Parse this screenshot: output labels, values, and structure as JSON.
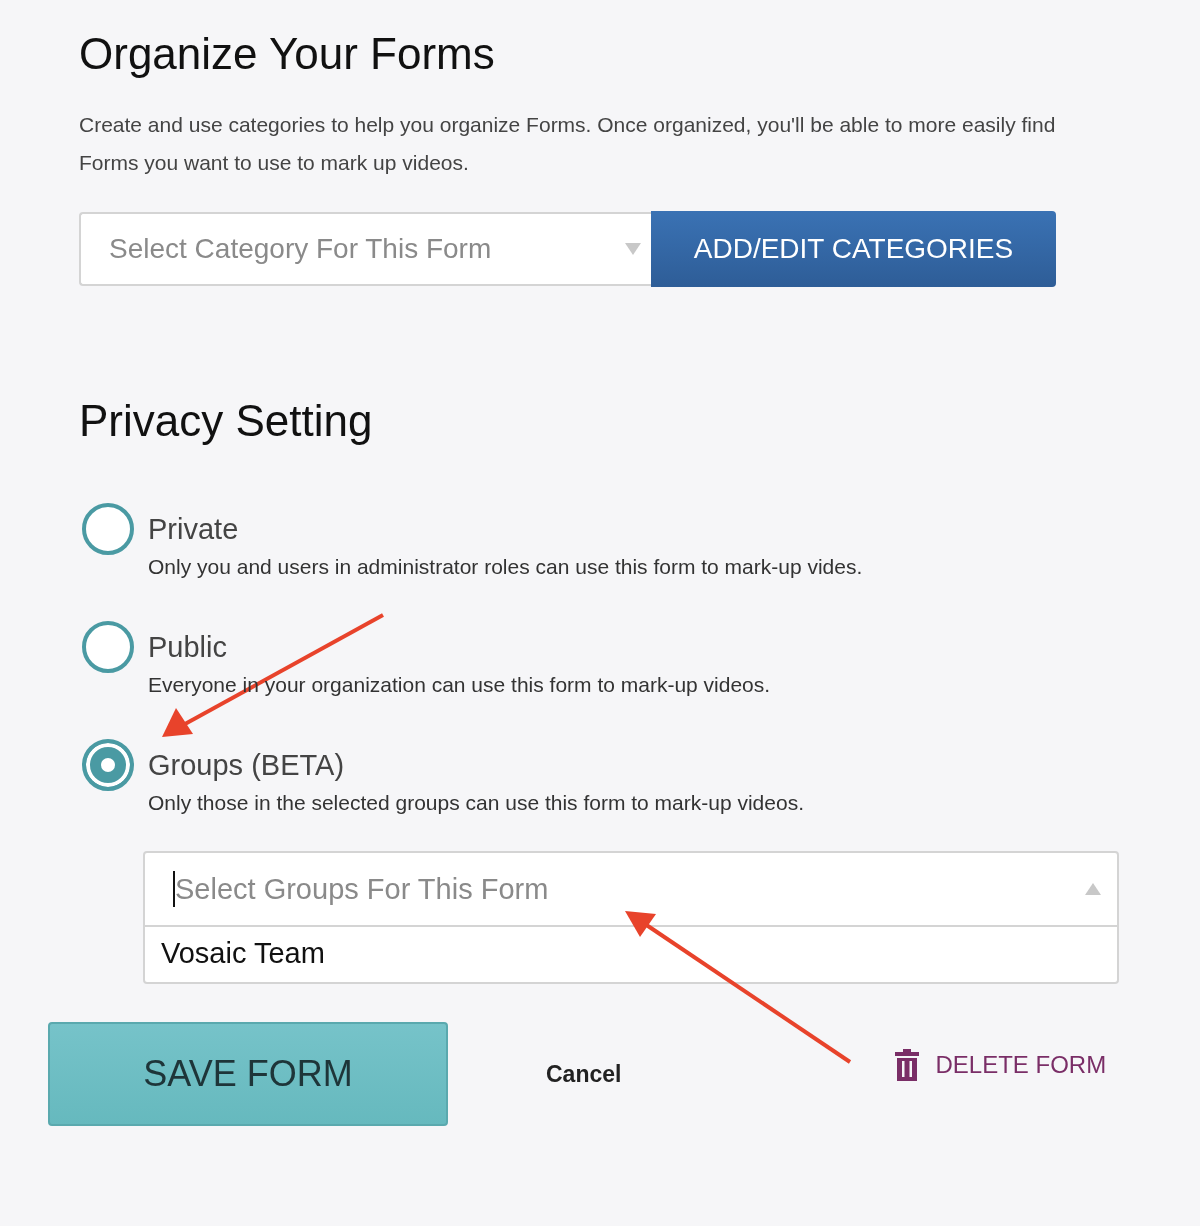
{
  "categories": {
    "title": "Organize Your Forms",
    "description": "Create and use categories to help you organize Forms. Once organized, you'll be able to more easily find Forms you want to use to mark up videos.",
    "select": {
      "placeholder": "Select Category For This Form",
      "expanded": false
    },
    "button": "ADD/EDIT CATEGORIES"
  },
  "privacy": {
    "title": "Privacy Setting",
    "options": [
      {
        "label": "Private",
        "description": "Only you and users in administrator roles can use this form to mark-up vides.",
        "selected": false
      },
      {
        "label": "Public",
        "description": "Everyone in your organization can use this form to mark-up videos.",
        "selected": false
      },
      {
        "label": "Groups (BETA)",
        "description": "Only those in the selected groups can use this form to mark-up videos.",
        "selected": true
      }
    ],
    "groups": {
      "placeholder": "Select Groups For This Form",
      "expanded": true,
      "options": [
        "Vosaic Team"
      ]
    }
  },
  "actions": {
    "save": "SAVE FORM",
    "cancel": "Cancel",
    "delete": "DELETE FORM"
  }
}
